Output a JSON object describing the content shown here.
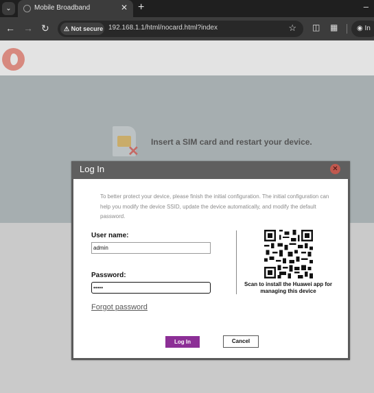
{
  "browser": {
    "tab_title": "Mobile Broadband",
    "tab_close": "✕",
    "new_tab": "+",
    "minimize": "–",
    "security_chip": "Not secure",
    "url": "192.168.1.1/html/nocard.html?index",
    "profile_label": "In"
  },
  "page": {
    "sim_message": "Insert a SIM card and restart your device."
  },
  "dialog": {
    "title": "Log In",
    "intro": "To better protect your device, please finish the initial configuration. The initial configuration can help you modify the device SSID, update the device automatically, and modify the default password.",
    "username_label": "User name:",
    "username_value": "admin",
    "password_label": "Password:",
    "password_value": "•••••",
    "forgot_link": "Forgot password",
    "qr_caption": "Scan to install the Huawei app for managing this device",
    "login_button": "Log In",
    "cancel_button": "Cancel"
  },
  "colors": {
    "login_button": "#8c2f96",
    "banner": "#a6aeb0",
    "logo": "#d7897f"
  }
}
